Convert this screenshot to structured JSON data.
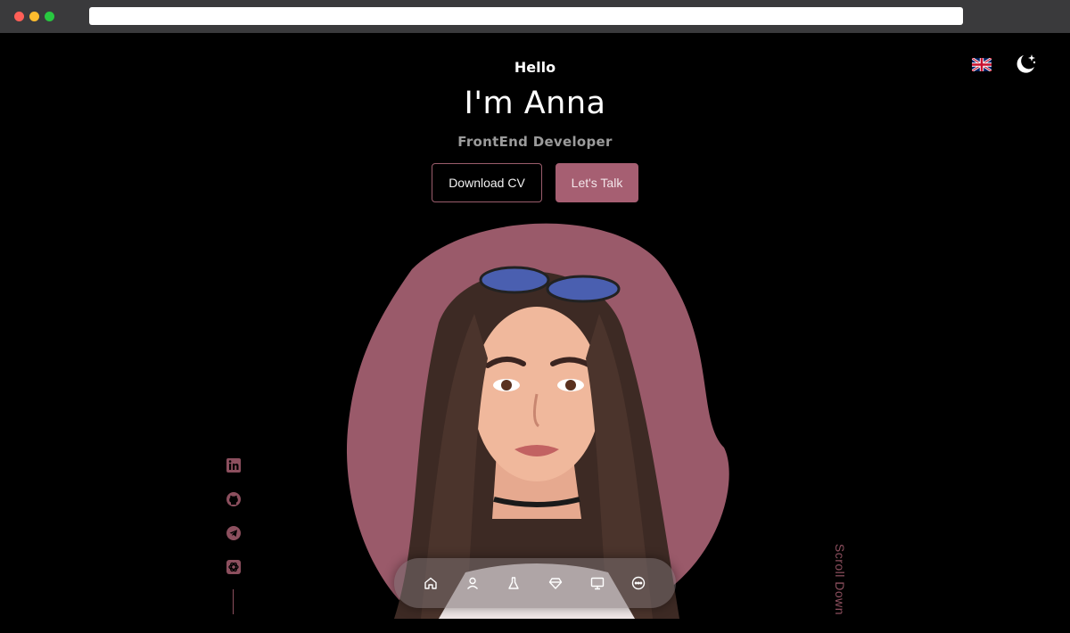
{
  "browser": {
    "url": ""
  },
  "header": {
    "language_flag": "uk-flag-icon",
    "theme_toggle": "moon-stars-icon"
  },
  "hero": {
    "greeting": "Hello",
    "name": "I'm Anna",
    "role": "FrontEnd Developer",
    "download_cv_label": "Download CV",
    "lets_talk_label": "Let's Talk"
  },
  "social": {
    "items": [
      "linkedin-icon",
      "github-icon",
      "telegram-icon",
      "openai-icon"
    ]
  },
  "scroll_down_label": "Scroll Down",
  "bottom_nav": {
    "items": [
      "home-icon",
      "user-icon",
      "flask-icon",
      "diamond-heart-icon",
      "monitor-icon",
      "chat-icon"
    ]
  },
  "colors": {
    "accent": "#a65f72",
    "background": "#000000",
    "muted_text": "#9b9b9b"
  }
}
